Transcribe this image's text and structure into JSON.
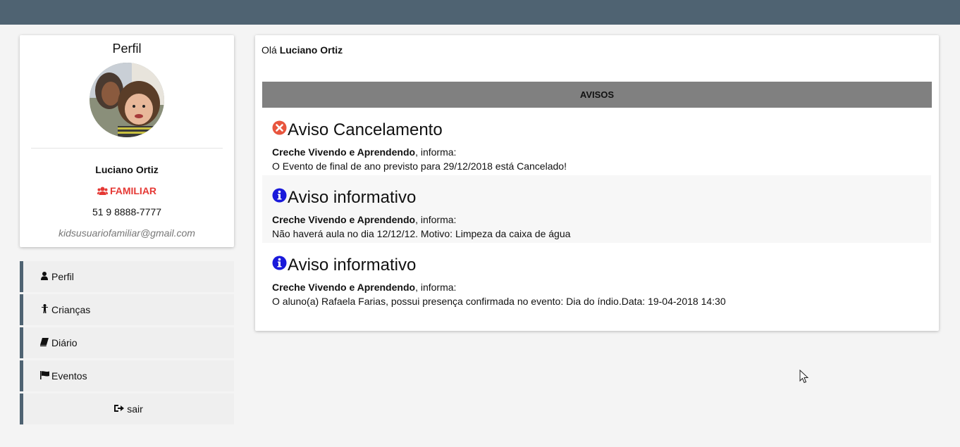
{
  "profile": {
    "title": "Perfil",
    "name": "Luciano Ortiz",
    "role": "FAMILIAR",
    "phone": "51 9 8888-7777",
    "email": "kidsusuariofamiliar@gmail.com"
  },
  "menu": {
    "items": [
      {
        "label": "Perfil",
        "icon": "user-icon"
      },
      {
        "label": "Crianças",
        "icon": "child-icon"
      },
      {
        "label": "Diário",
        "icon": "book-icon"
      },
      {
        "label": "Eventos",
        "icon": "flag-icon"
      },
      {
        "label": "sair",
        "icon": "sign-out-icon"
      }
    ]
  },
  "main": {
    "greeting_prefix": "Olá",
    "greeting_name": "Luciano Ortiz",
    "avisos_header": "AVISOS",
    "notices": [
      {
        "title": "Aviso Cancelamento",
        "icon": "times-circle-icon",
        "sender": "Creche Vivendo e Aprendendo",
        "informa": ", informa:",
        "message": "O Evento de final de ano previsto para 29/12/2018 está Cancelado!"
      },
      {
        "title": "Aviso informativo",
        "icon": "info-circle-icon",
        "sender": "Creche Vivendo e Aprendendo",
        "informa": ", informa:",
        "message": "Não haverá aula no dia 12/12/12. Motivo: Limpeza da caixa de água"
      },
      {
        "title": "Aviso informativo",
        "icon": "info-circle-icon",
        "sender": "Creche Vivendo e Aprendendo",
        "informa": ", informa:",
        "message": "O aluno(a) Rafaela Farias, possui presença confirmada no evento: Dia do índio.Data: 19-04-2018 14:30"
      }
    ]
  },
  "colors": {
    "topbar": "#4f6372",
    "role": "#e53935",
    "cancel_icon": "#e8553e",
    "info_icon": "#1a1adb",
    "avisos_header": "#808080"
  }
}
